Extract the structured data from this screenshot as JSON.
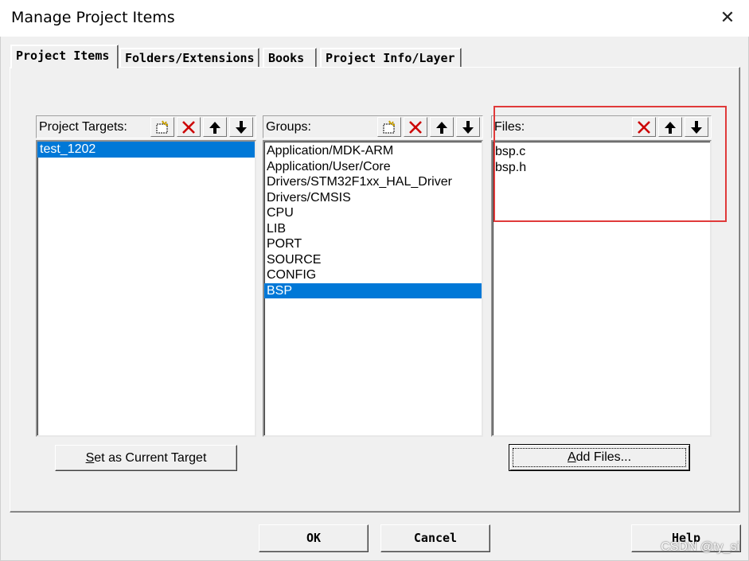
{
  "window": {
    "title": "Manage Project Items"
  },
  "tabs": [
    {
      "label": "Project Items"
    },
    {
      "label": "Folders/Extensions"
    },
    {
      "label": "Books"
    },
    {
      "label": "Project Info/Layer"
    }
  ],
  "targets": {
    "header": "Project Targets:",
    "items": [
      "test_1202"
    ],
    "selected_index": 0
  },
  "groups": {
    "header": "Groups:",
    "items": [
      "Application/MDK-ARM",
      "Application/User/Core",
      "Drivers/STM32F1xx_HAL_Driver",
      "Drivers/CMSIS",
      "CPU",
      "LIB",
      "PORT",
      "SOURCE",
      "CONFIG",
      "BSP"
    ],
    "selected_index": 9
  },
  "files": {
    "header": "Files:",
    "items": [
      "bsp.c",
      "bsp.h"
    ]
  },
  "buttons": {
    "set_target_pre": "S",
    "set_target_rest": "et as Current Target",
    "add_files_pre": "A",
    "add_files_rest": "dd Files...",
    "ok": "OK",
    "cancel": "Cancel",
    "help": "Help"
  },
  "watermark": "CSDN @ty_si",
  "colors": {
    "selection": "#0078d7",
    "highlight_box": "#e03a3a",
    "delete_icon": "#cc0000"
  },
  "icons": {
    "new": "new-item-icon",
    "delete": "delete-icon",
    "up": "arrow-up-icon",
    "down": "arrow-down-icon",
    "close": "close-icon"
  }
}
